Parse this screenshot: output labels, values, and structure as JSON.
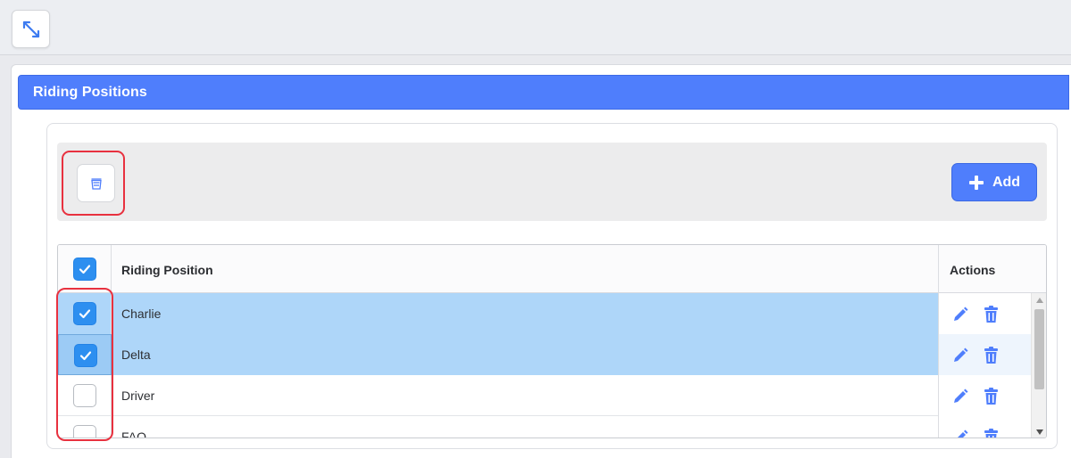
{
  "toolbar": {
    "expand_icon": "expand-arrows-icon"
  },
  "section": {
    "title": "Riding Positions"
  },
  "grid_toolbar": {
    "delete_icon": "trash-icon",
    "add_label": "Add",
    "add_icon": "plus-icon"
  },
  "table": {
    "columns": {
      "name": "Riding Position",
      "actions": "Actions"
    },
    "header_checked": true,
    "rows": [
      {
        "name": "Charlie",
        "checked": true,
        "selected": true
      },
      {
        "name": "Delta",
        "checked": true,
        "selected": true
      },
      {
        "name": "Driver",
        "checked": false,
        "selected": false
      },
      {
        "name": "FAQ",
        "checked": false,
        "selected": false
      }
    ]
  },
  "colors": {
    "accent": "#4f7efc",
    "checkbox": "#2d8ff0",
    "selected_row": "#aed6f9",
    "highlight": "#e8313f"
  }
}
